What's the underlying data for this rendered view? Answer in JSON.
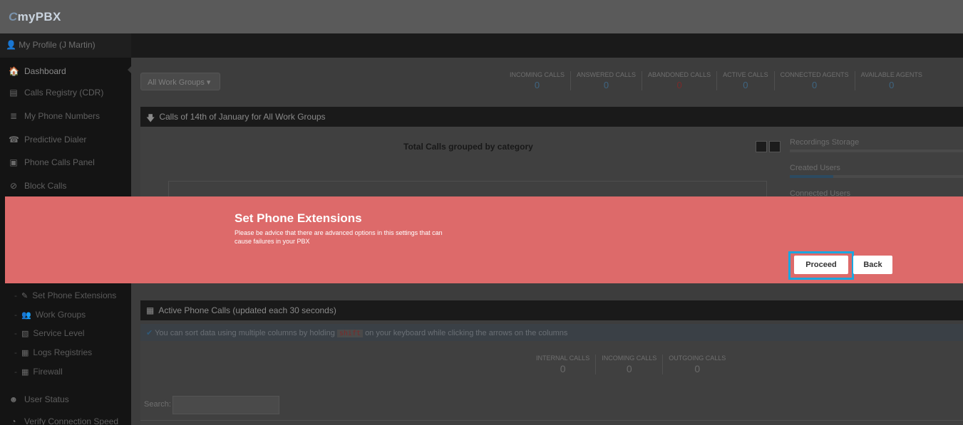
{
  "app": {
    "logo_prefix": "C",
    "logo_text": "myPBX"
  },
  "sidebar": {
    "profile": "My Profile (J Martin)",
    "items": [
      {
        "label": "Dashboard",
        "icon": "home-icon",
        "glyph": "🏠"
      },
      {
        "label": "Calls Registry (CDR)",
        "icon": "list-icon",
        "glyph": "▤"
      },
      {
        "label": "My Phone Numbers",
        "icon": "menu-icon",
        "glyph": "≣"
      },
      {
        "label": "Predictive Dialer",
        "icon": "phone-icon",
        "glyph": "☎"
      },
      {
        "label": "Phone Calls Panel",
        "icon": "panel-icon",
        "glyph": "▣"
      },
      {
        "label": "Block Calls",
        "icon": "block-icon",
        "glyph": "⊘"
      }
    ],
    "subitems": [
      {
        "label": "Set Phone Extensions",
        "icon": "edit-icon",
        "glyph": "✎"
      },
      {
        "label": "Work Groups",
        "icon": "users-icon",
        "glyph": "👥"
      },
      {
        "label": "Service Level",
        "icon": "image-icon",
        "glyph": "▧"
      },
      {
        "label": "Logs Registries",
        "icon": "book-icon",
        "glyph": "▦"
      },
      {
        "label": "Firewall",
        "icon": "grid-icon",
        "glyph": "▦"
      }
    ],
    "bottom_items": [
      {
        "label": "User Status",
        "icon": "user-status-icon",
        "glyph": "☻"
      },
      {
        "label": "Verify Connection Speed",
        "icon": "speed-icon",
        "glyph": "◔"
      }
    ]
  },
  "toolbar": {
    "workgroups_label": "All Work Groups ▾"
  },
  "stats": [
    {
      "label": "INCOMING CALLS",
      "value": "0"
    },
    {
      "label": "ANSWERED CALLS",
      "value": "0"
    },
    {
      "label": "ABANDONED CALLS",
      "value": "0"
    },
    {
      "label": "ACTIVE CALLS",
      "value": "0"
    },
    {
      "label": "CONNECTED AGENTS",
      "value": "0"
    },
    {
      "label": "AVAILABLE AGENTS",
      "value": "0"
    }
  ],
  "calls_section": {
    "title": "Calls of 14th of January for All Work Groups"
  },
  "chart": {
    "title": "Total Calls grouped by category"
  },
  "metrics": [
    {
      "label": "Recordings Storage",
      "fill": 0
    },
    {
      "label": "Created Users",
      "fill": 0.25
    },
    {
      "label": "Connected Users",
      "fill": 0
    }
  ],
  "alert": {
    "title": "Set Phone Extensions",
    "message": "Please be advice that there are advanced options in this settings that can cause failures in your PBX",
    "proceed_label": "Proceed",
    "back_label": "Back",
    "ring_color": "#1aa7e0",
    "bg_color": "#dd6a6a"
  },
  "active_calls": {
    "title": "Active Phone Calls (updated each 30 seconds)",
    "info_before": "You can sort data using multiple columns by holding",
    "info_key": "shift",
    "info_after": "on your keyboard while clicking the arrows on the columns",
    "stats": [
      {
        "label": "INTERNAL CALLS",
        "value": "0"
      },
      {
        "label": "INCOMING CALLS",
        "value": "0"
      },
      {
        "label": "OUTGOING CALLS",
        "value": "0"
      }
    ],
    "search_label": "Search:"
  }
}
